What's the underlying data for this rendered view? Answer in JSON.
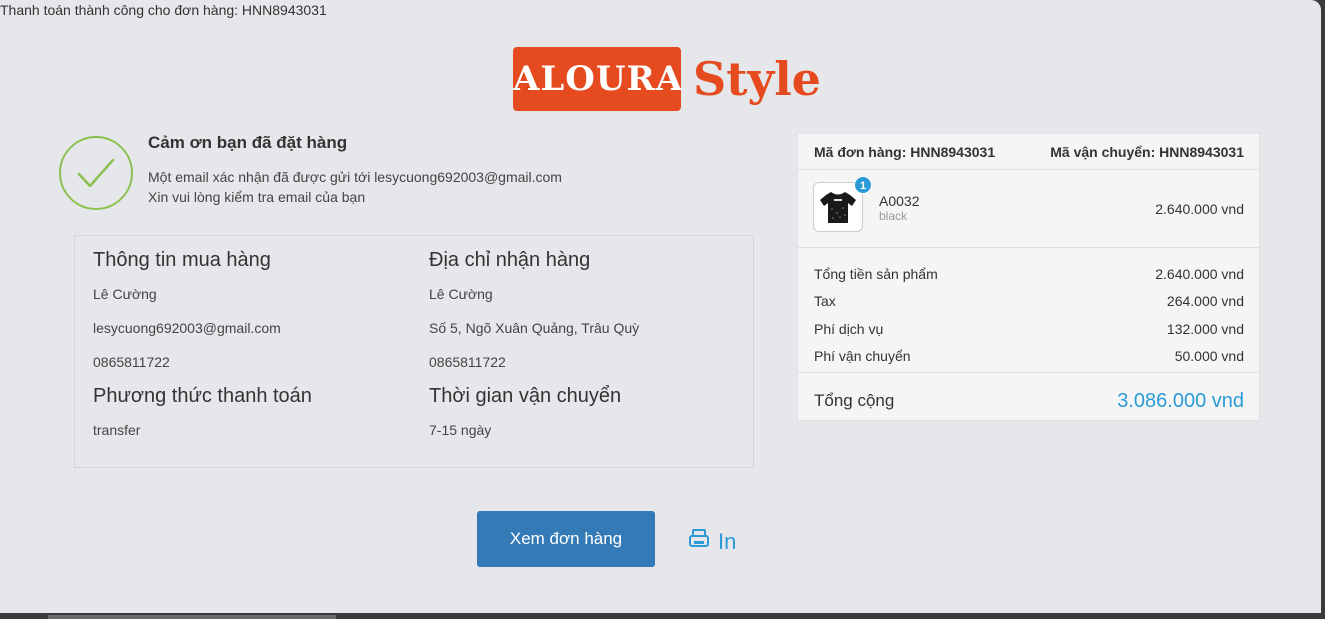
{
  "top_bar": {
    "status": "Thanh toán thành công cho đơn hàng: HNN8943031"
  },
  "logo": {
    "box_text": "ALOURA",
    "style_text": "Style",
    "brand_color": "#e64a1f"
  },
  "thanks": {
    "title": "Cảm ơn bạn đã đặt hàng",
    "line1": "Một email xác nhận đã được gửi tới lesycuong692003@gmail.com",
    "line2": "Xin vui lòng kiểm tra email của bạn",
    "icon": "checkmark-icon"
  },
  "buyer": {
    "title": "Thông tin mua hàng",
    "name": "Lê Cường",
    "email": "lesycuong692003@gmail.com",
    "phone": "0865811722"
  },
  "shipping_address": {
    "title": "Địa chỉ nhận hàng",
    "name": "Lê Cường",
    "address": "Số 5, Ngõ Xuân Quảng, Trâu Quỳ",
    "phone": "0865811722"
  },
  "payment": {
    "title": "Phương thức thanh toán",
    "method": "transfer"
  },
  "delivery": {
    "title": "Thời gian vận chuyển",
    "duration": "7-15 ngày"
  },
  "summary": {
    "order_code": "Mã đơn hàng: HNN8943031",
    "shipping_code": "Mã vận chuyển: HNN8943031",
    "product": {
      "name": "A0032",
      "variant": "black",
      "price": "2.640.000 vnd",
      "quantity": "1",
      "thumb_icon": "tshirt-icon"
    },
    "lines": [
      {
        "label": "Tổng tiền sản phẩm",
        "value": "2.640.000 vnd"
      },
      {
        "label": "Tax",
        "value": "264.000 vnd"
      },
      {
        "label": "Phí dịch vụ",
        "value": "132.000 vnd"
      },
      {
        "label": "Phí vận chuyển",
        "value": "50.000 vnd"
      }
    ],
    "total_label": "Tổng cộng",
    "total_value": "3.086.000 vnd",
    "accent_color": "#2a9bd6"
  },
  "actions": {
    "view_order": "Xem đơn hàng",
    "print": "In",
    "print_icon": "printer-icon"
  }
}
